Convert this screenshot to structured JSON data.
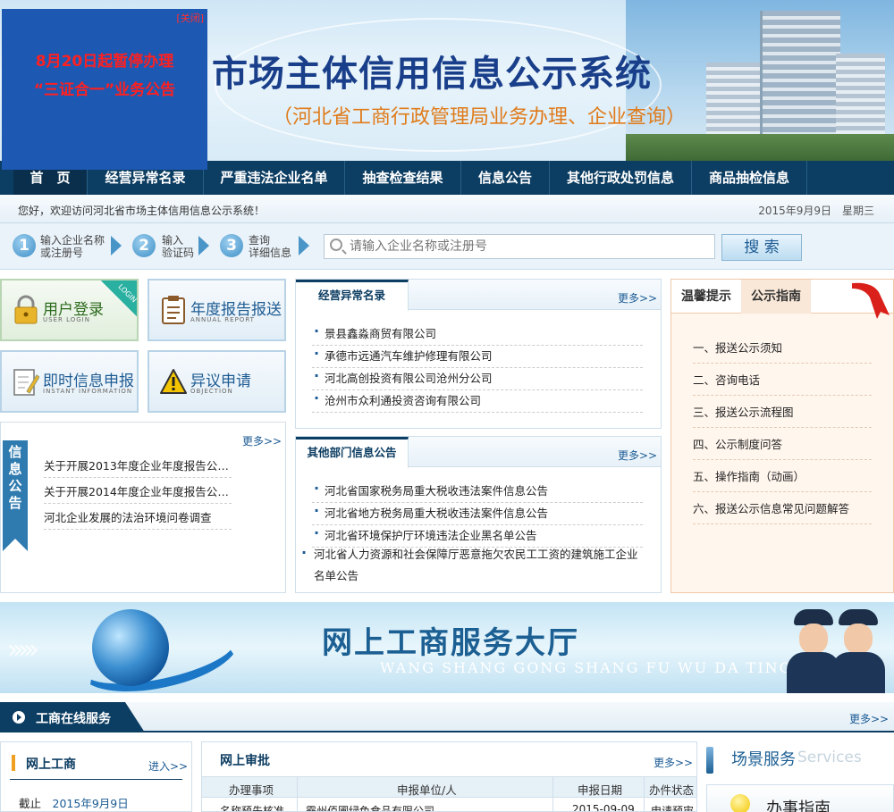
{
  "popup": {
    "close_label": "[关闭]",
    "line1": "8月20日起暂停办理",
    "line2": "“三证合一”业务公告"
  },
  "header": {
    "title": "市场主体信用信息公示系统",
    "subtitle": "（河北省工商行政管理局业务办理、企业查询）"
  },
  "nav": {
    "items": [
      {
        "label": "首　页",
        "active": true
      },
      {
        "label": "经营异常名录"
      },
      {
        "label": "严重违法企业名单"
      },
      {
        "label": "抽查检查结果"
      },
      {
        "label": "信息公告"
      },
      {
        "label": "其他行政处罚信息"
      },
      {
        "label": "商品抽检信息"
      }
    ]
  },
  "greeting": {
    "text": "您好，欢迎访问河北省市场主体信用信息公示系统！",
    "date": "2015年9月9日　星期三"
  },
  "search": {
    "steps": [
      {
        "num": "1",
        "line1": "输入企业名称",
        "line2": "或注册号"
      },
      {
        "num": "2",
        "line1": "输入",
        "line2": "验证码"
      },
      {
        "num": "3",
        "line1": "查询",
        "line2": "详细信息"
      }
    ],
    "placeholder": "请输入企业名称或注册号",
    "button": "搜 索"
  },
  "tiles": [
    {
      "title": "用户登录",
      "sub": "USER LOGIN",
      "ribbon": "LOGIN",
      "icon": "lock-icon"
    },
    {
      "title": "年度报告报送",
      "sub": "ANNUAL REPORT",
      "icon": "clipboard-icon"
    },
    {
      "title": "即时信息申报",
      "sub": "INSTANT INFORMATION",
      "icon": "edit-doc-icon"
    },
    {
      "title": "异议申请",
      "sub": "OBJECTION",
      "icon": "warning-icon"
    }
  ],
  "info_notice": {
    "side_label": "信息公告",
    "more": "更多>>",
    "items": [
      "关于开展2013年度企业年度报告公示...",
      "关于开展2014年度企业年度报告公示...",
      "河北企业发展的法治环境问卷调查"
    ]
  },
  "abnormal_list": {
    "tab": "经营异常名录",
    "more": "更多>>",
    "items": [
      "景县鑫淼商贸有限公司",
      "承德市远通汽车维护修理有限公司",
      "河北高创投资有限公司沧州分公司",
      "沧州市众利通投资咨询有限公司"
    ]
  },
  "other_dept": {
    "tab": "其他部门信息公告",
    "more": "更多>>",
    "items": [
      "河北省国家税务局重大税收违法案件信息公告",
      "河北省地方税务局重大税收违法案件信息公告",
      "河北省环境保护厅环境违法企业黑名单公告",
      "河北省人力资源和社会保障厅恶意拖欠农民工工资的建筑施工企业名单公告"
    ]
  },
  "tips": {
    "tab1": "温馨提示",
    "tab2": "公示指南",
    "items": [
      "一、报送公示须知",
      "二、咨询电话",
      "三、报送公示流程图",
      "四、公示制度问答",
      "五、操作指南（动画）",
      "六、报送公示信息常见问题解答"
    ]
  },
  "hall": {
    "title": "网上工商服务大厅",
    "subtitle": "WANG SHANG GONG SHANG FU WU DA TING"
  },
  "section": {
    "title": "工商在线服务",
    "more": "更多>>"
  },
  "online_biz": {
    "title": "网上工商",
    "enter": "进入>>",
    "asof_label": "截止",
    "asof_date": "2015年9月9日"
  },
  "online_approval": {
    "title": "网上审批",
    "more": "更多>>",
    "columns": [
      "办理事项",
      "申报单位/人",
      "申报日期",
      "办件状态"
    ],
    "row": [
      "名称预先核准",
      "霸州佰圃绿色食品有限公司",
      "2015-09-09",
      "申请预审"
    ]
  },
  "scene": {
    "title": "场景服务",
    "title_en": "Services",
    "card": "办事指南"
  },
  "colors": {
    "nav": "#0c3d62",
    "popup": "#1d58b3",
    "alert_red": "#ff2020",
    "subtitle_orange": "#e07b1a"
  }
}
